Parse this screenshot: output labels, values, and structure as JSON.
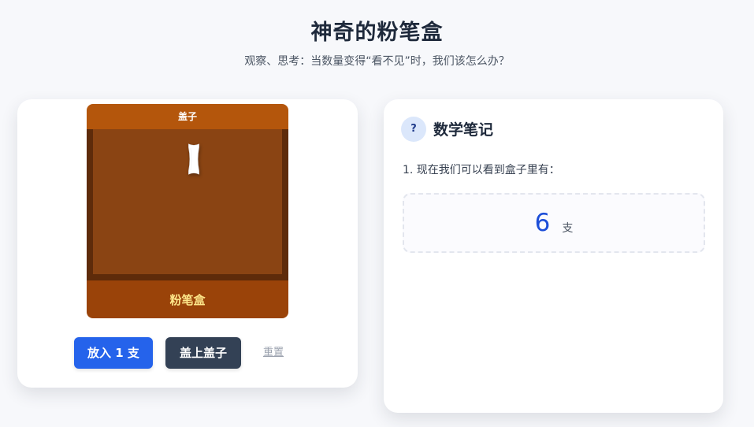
{
  "header": {
    "title": "神奇的粉笔盒",
    "subtitle": "观察、思考：当数量变得“看不见”时，我们该怎么办？"
  },
  "box": {
    "lid_label": "盖子",
    "front_label": "粉笔盒",
    "chalk_count": 1,
    "colors": {
      "lid": "#b4560c",
      "wall": "#5e2b0a",
      "inside": "#8a4413",
      "front": "#9a4309",
      "front_text": "#fde68a",
      "chalk": "#ffffff"
    }
  },
  "controls": {
    "add_label": "放入 1 支",
    "lid_label": "盖上盖子",
    "reset_label": "重置",
    "colors": {
      "add": "#2563eb",
      "lid": "#334155"
    }
  },
  "notes": {
    "icon": "question-icon",
    "icon_glyph": "?",
    "title": "数学笔记",
    "line1": "1. 现在我们可以看到盒子里有：",
    "count_value": "6",
    "count_unit": "支",
    "accent": "#1d4ed8"
  }
}
